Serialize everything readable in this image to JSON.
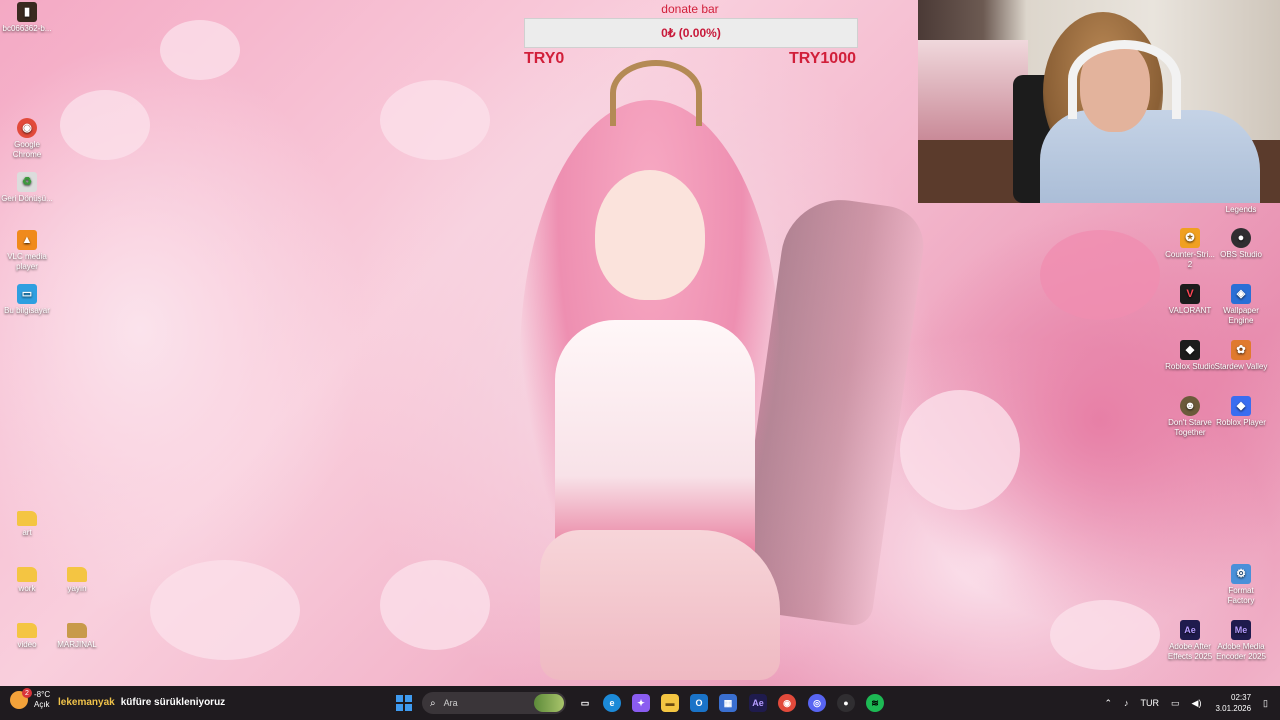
{
  "desktop_icons": {
    "left": [
      {
        "label": "bc066362-b...",
        "icon": "dark-app-icon",
        "color": "#3a2a20"
      },
      {
        "label": "Google Chrome",
        "icon": "chrome-icon",
        "color": "#e24a3b"
      },
      {
        "label": "Geri Dönüşü...",
        "icon": "recycle-bin-icon",
        "color": "#dcdcdc"
      },
      {
        "label": "VLC media player",
        "icon": "vlc-icon",
        "color": "#f08a1c"
      },
      {
        "label": "Bu bilgisayar",
        "icon": "computer-icon",
        "color": "#2f9fe0"
      },
      {
        "label": "art",
        "icon": "folder-icon",
        "color": "#f4c542"
      },
      {
        "label": "work",
        "icon": "folder-icon",
        "color": "#f4c542"
      },
      {
        "label": "yayın",
        "icon": "folder-icon",
        "color": "#f4c542"
      },
      {
        "label": "video",
        "icon": "folder-icon",
        "color": "#f4c542"
      },
      {
        "label": "MARJINAL",
        "icon": "folder-icon",
        "color": "#c89a4a"
      }
    ],
    "right": [
      {
        "label": "Legends",
        "icon": "app-icon",
        "color": "#555"
      },
      {
        "label": "Counter-Stri... 2",
        "icon": "counter-strike-icon",
        "color": "#f0a020"
      },
      {
        "label": "OBS Studio",
        "icon": "obs-icon",
        "color": "#302e31"
      },
      {
        "label": "VALORANT",
        "icon": "valorant-icon",
        "color": "#ff4655"
      },
      {
        "label": "Wallpaper Engine",
        "icon": "wallpaper-engine-icon",
        "color": "#2a6fd6"
      },
      {
        "label": "Roblox Studio",
        "icon": "roblox-studio-icon",
        "color": "#1c1c1c"
      },
      {
        "label": "Stardew Valley",
        "icon": "stardew-valley-icon",
        "color": "#e07a2e"
      },
      {
        "label": "Don't Starve Together",
        "icon": "dont-starve-icon",
        "color": "#6b5a3a"
      },
      {
        "label": "Roblox Player",
        "icon": "roblox-player-icon",
        "color": "#3a6df0"
      },
      {
        "label": "Format Factory",
        "icon": "format-factory-icon",
        "color": "#4a90d9"
      },
      {
        "label": "Adobe After Effects 2025",
        "icon": "after-effects-icon",
        "color": "#1f1b4d"
      },
      {
        "label": "Adobe Media Encoder 2025",
        "icon": "media-encoder-icon",
        "color": "#1f1b4d"
      }
    ]
  },
  "donate": {
    "title": "donate bar",
    "progress_text": "0₺ (0.00%)",
    "progress_fraction": 0,
    "min_label": "TRY0",
    "max_label": "TRY1000"
  },
  "taskbar": {
    "weather_temp": "-8°C",
    "weather_desc": "Açık",
    "weather_badge": "2",
    "ticker_user": "lekemanyak",
    "ticker_text": "küfüre sürükleniyoruz",
    "search_placeholder": "Ara",
    "apps": [
      {
        "name": "task-view",
        "glyph": "▭",
        "color": "#4a4a4a"
      },
      {
        "name": "edge",
        "glyph": "e",
        "color": "#1c8ad8"
      },
      {
        "name": "copilot",
        "glyph": "✦",
        "color": "#8a5cf0"
      },
      {
        "name": "file-explorer",
        "glyph": "▬",
        "color": "#f4c542"
      },
      {
        "name": "outlook",
        "glyph": "O",
        "color": "#1a73c8"
      },
      {
        "name": "store",
        "glyph": "▦",
        "color": "#3a6fd0"
      },
      {
        "name": "after-effects",
        "glyph": "Ae",
        "color": "#1f1b4d"
      },
      {
        "name": "chrome",
        "glyph": "◉",
        "color": "#e24a3b"
      },
      {
        "name": "discord",
        "glyph": "◎",
        "color": "#5865f2"
      },
      {
        "name": "obs",
        "glyph": "●",
        "color": "#302e31"
      },
      {
        "name": "spotify",
        "glyph": "≋",
        "color": "#1db954"
      }
    ],
    "tray_language": "TUR",
    "time": "02:37",
    "date": "3.01.2026"
  }
}
